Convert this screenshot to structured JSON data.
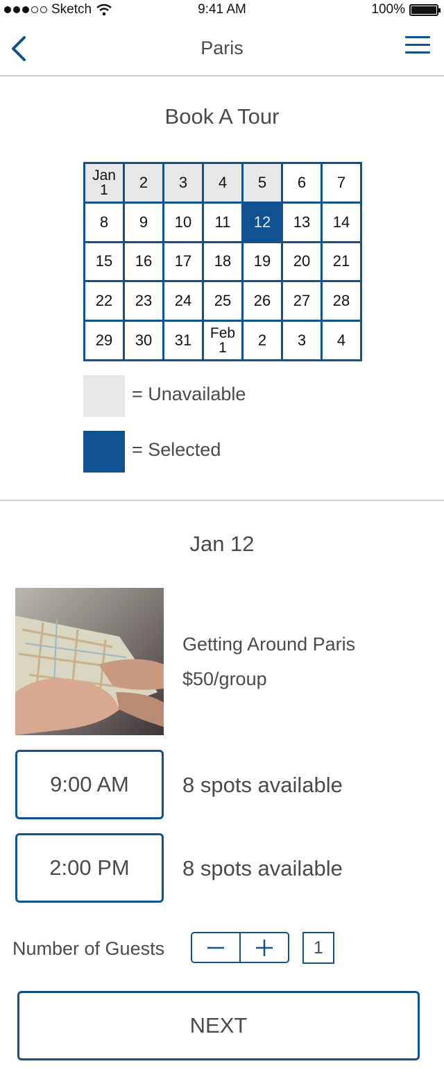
{
  "status_bar": {
    "carrier": "Sketch",
    "time": "9:41 AM",
    "battery": "100%"
  },
  "nav": {
    "title": "Paris",
    "back_icon": "chevron-left-icon",
    "menu_icon": "hamburger-menu-icon"
  },
  "booking": {
    "title": "Book A Tour"
  },
  "calendar": {
    "days": [
      {
        "label": "Jan\n1",
        "state": "unavailable"
      },
      {
        "label": "2",
        "state": "unavailable"
      },
      {
        "label": "3",
        "state": "unavailable"
      },
      {
        "label": "4",
        "state": "unavailable"
      },
      {
        "label": "5",
        "state": "unavailable"
      },
      {
        "label": "6",
        "state": "available"
      },
      {
        "label": "7",
        "state": "available"
      },
      {
        "label": "8",
        "state": "available"
      },
      {
        "label": "9",
        "state": "available"
      },
      {
        "label": "10",
        "state": "available"
      },
      {
        "label": "11",
        "state": "available"
      },
      {
        "label": "12",
        "state": "selected"
      },
      {
        "label": "13",
        "state": "available"
      },
      {
        "label": "14",
        "state": "available"
      },
      {
        "label": "15",
        "state": "available"
      },
      {
        "label": "16",
        "state": "available"
      },
      {
        "label": "17",
        "state": "available"
      },
      {
        "label": "18",
        "state": "available"
      },
      {
        "label": "19",
        "state": "available"
      },
      {
        "label": "20",
        "state": "available"
      },
      {
        "label": "21",
        "state": "available"
      },
      {
        "label": "22",
        "state": "available"
      },
      {
        "label": "23",
        "state": "available"
      },
      {
        "label": "24",
        "state": "available"
      },
      {
        "label": "25",
        "state": "available"
      },
      {
        "label": "26",
        "state": "available"
      },
      {
        "label": "27",
        "state": "available"
      },
      {
        "label": "28",
        "state": "available"
      },
      {
        "label": "29",
        "state": "available"
      },
      {
        "label": "30",
        "state": "available"
      },
      {
        "label": "31",
        "state": "available"
      },
      {
        "label": "Feb\n1",
        "state": "available"
      },
      {
        "label": "2",
        "state": "available"
      },
      {
        "label": "3",
        "state": "available"
      },
      {
        "label": "4",
        "state": "available"
      }
    ]
  },
  "legend": {
    "unavailable_label": "= Unavailable",
    "selected_label": "= Selected"
  },
  "colors": {
    "accent": "#10528f",
    "unavailable": "#e7e7e7",
    "selected_text": "#dce9f5"
  },
  "selected_date": "Jan 12",
  "tour": {
    "name": "Getting Around Paris",
    "price": "$50/group"
  },
  "times": [
    {
      "time": "9:00 AM",
      "spots": "8 spots available"
    },
    {
      "time": "2:00 PM",
      "spots": "8 spots available"
    }
  ],
  "guests": {
    "label": "Number of Guests",
    "minus_icon": "minus-icon",
    "plus_icon": "plus-icon",
    "count": "1"
  },
  "next_label": "NEXT"
}
